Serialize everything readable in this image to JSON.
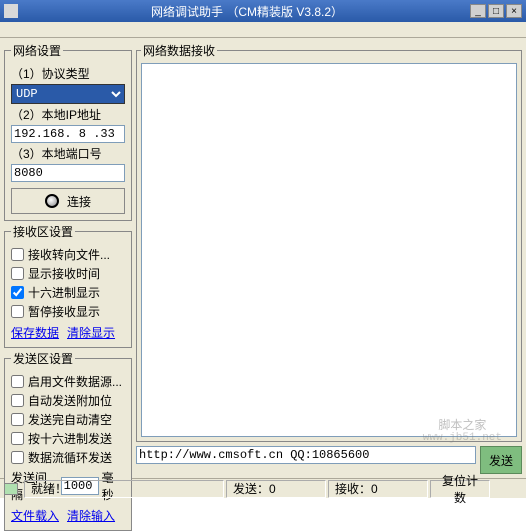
{
  "window": {
    "title": "网络调试助手 （CM精装版 V3.8.2）"
  },
  "netSettings": {
    "legend": "网络设置",
    "protoLabel": "（1）协议类型",
    "protoValue": "UDP",
    "ipLabel": "（2）本地IP地址",
    "ipValue": "192.168. 8 .33",
    "portLabel": "（3）本地端口号",
    "portValue": "8080",
    "connectLabel": "连接"
  },
  "recvSettings": {
    "legend": "接收区设置",
    "chk1": "接收转向文件...",
    "chk2": "显示接收时间",
    "chk3": "十六进制显示",
    "chk4": "暂停接收显示",
    "saveLink": "保存数据",
    "clearLink": "清除显示"
  },
  "sendSettings": {
    "legend": "发送区设置",
    "chk1": "启用文件数据源...",
    "chk2": "自动发送附加位",
    "chk3": "发送完自动清空",
    "chk4": "按十六进制发送",
    "chk5": "数据流循环发送",
    "intervalLabel": "发送间隔",
    "intervalValue": "1000",
    "intervalUnit": "毫秒",
    "loadLink": "文件载入",
    "clearLink": "清除输入"
  },
  "recvPanel": {
    "legend": "网络数据接收"
  },
  "sendPanel": {
    "inputValue": "http://www.cmsoft.cn QQ:10865600",
    "sendBtn": "发送"
  },
  "status": {
    "ready": "就绪！",
    "txLabel": "发送：",
    "txValue": "0",
    "rxLabel": "接收：",
    "rxValue": "0",
    "resetLabel": "复位计数"
  },
  "watermark": {
    "line1": "脚本之家",
    "line2": "www.jb51.net"
  }
}
